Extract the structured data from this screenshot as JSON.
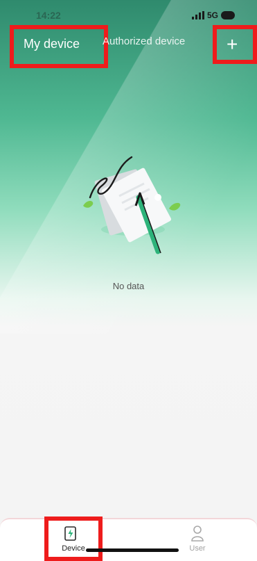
{
  "status": {
    "time": "14:22",
    "network": "5G"
  },
  "header": {
    "tabs": [
      {
        "label": "My device"
      },
      {
        "label": "Authorized device"
      }
    ],
    "add_label": "+"
  },
  "empty_state": {
    "text": "No data",
    "illustration": "document-signing-illustration"
  },
  "tabbar": {
    "items": [
      {
        "label": "Device",
        "icon": "device-charge-icon",
        "active": true
      },
      {
        "label": "User",
        "icon": "user-icon",
        "active": false
      }
    ]
  },
  "colors": {
    "primary": "#2f8a6d",
    "accent": "#2db37a",
    "highlight_box": "#ee1c1c"
  }
}
